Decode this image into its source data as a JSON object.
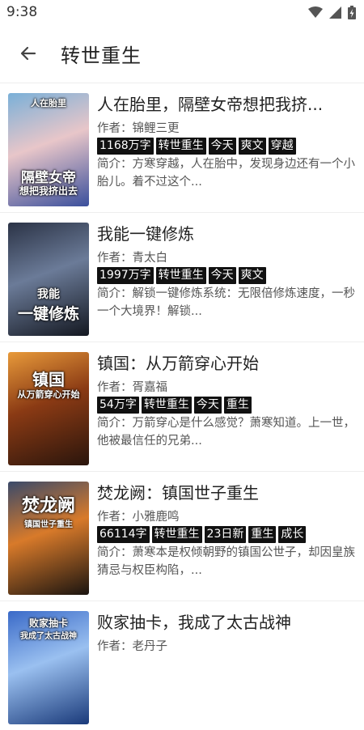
{
  "status_bar": {
    "time": "9:38",
    "icons": [
      "wifi-icon",
      "signal-icon",
      "battery-charging-icon"
    ]
  },
  "app_bar": {
    "title": "转世重生",
    "back_icon": "arrow-left-icon"
  },
  "books": [
    {
      "title": "人在胎里，隔壁女帝想把我挤...",
      "author": "作者：锦鲤三更",
      "tags": [
        "1168万字",
        "转世重生",
        "今天",
        "爽文",
        "穿越"
      ],
      "summary": "简介：方寒穿越，人在胎中，发现身边还有一个小胎儿。着不过这个...",
      "cover_text": [
        "人在胎里",
        "隔壁女帝",
        "想把我挤出去"
      ],
      "cover_colors": [
        "#7ab0d8",
        "#e8c6c9",
        "#3a4f9c"
      ]
    },
    {
      "title": "我能一键修炼",
      "author": "作者：青太白",
      "tags": [
        "1997万字",
        "转世重生",
        "今天",
        "爽文"
      ],
      "summary": "简介：解锁一键修炼系统：无限倍修炼速度，一秒一个大境界！解锁...",
      "cover_text": [
        "我能",
        "一键修炼"
      ],
      "cover_colors": [
        "#2b3346",
        "#6b7b98",
        "#141821"
      ]
    },
    {
      "title": "镇国：从万箭穿心开始",
      "author": "作者：胥嘉福",
      "tags": [
        "54万字",
        "转世重生",
        "今天",
        "重生"
      ],
      "summary": "简介：万箭穿心是什么感觉？萧寒知道。上一世，他被最信任的兄弟...",
      "cover_text": [
        "镇国",
        "从万箭穿心开始"
      ],
      "cover_colors": [
        "#e89a3a",
        "#8a3a14",
        "#2a150c"
      ]
    },
    {
      "title": "焚龙阙：镇国世子重生",
      "author": "作者：小雅鹿鸣",
      "tags": [
        "66114字",
        "转世重生",
        "23日新",
        "重生",
        "成长"
      ],
      "summary": "简介：萧寒本是权倾朝野的镇国公世子，却因皇族猜忌与权臣构陷，...",
      "cover_text": [
        "焚龙阙",
        "镇国世子重生"
      ],
      "cover_colors": [
        "#3a4a6a",
        "#d87a2a",
        "#1a1410"
      ]
    },
    {
      "title": "败家抽卡，我成了太古战神",
      "author": "作者：老丹子",
      "tags": [],
      "summary": "",
      "cover_text": [
        "败家抽卡",
        "我成了太古战神"
      ],
      "cover_colors": [
        "#3a6ac8",
        "#9ac0f0",
        "#1a3a7a"
      ]
    }
  ]
}
